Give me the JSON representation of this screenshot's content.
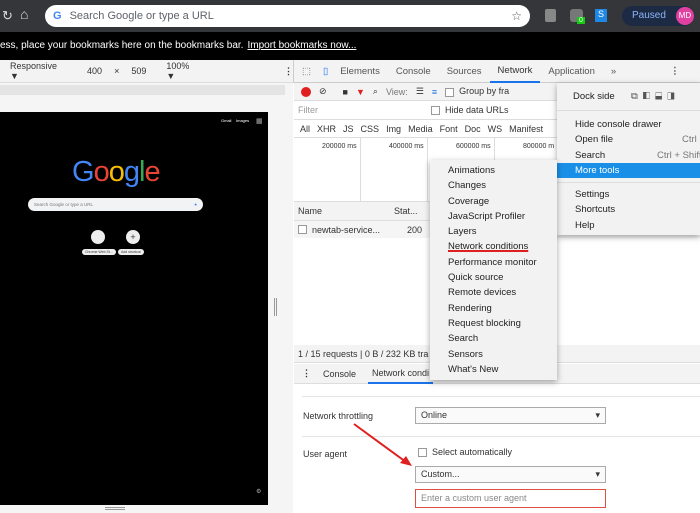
{
  "browser": {
    "address_placeholder": "Search Google or type a URL",
    "profile_status": "Paused",
    "avatar": "MD",
    "ext_badge": "0"
  },
  "bookmarks_bar": {
    "message": "ess, place your bookmarks here on the bookmarks bar.",
    "import_link": "Import bookmarks now..."
  },
  "device_toolbar": {
    "device": "Responsive ▼",
    "width": "400",
    "x": "×",
    "height": "509",
    "zoom": "100% ▼"
  },
  "page": {
    "logo": "Google",
    "links": [
      "Gmail",
      "Images"
    ],
    "search_placeholder": "Search Google or type a URL",
    "shortcuts": [
      "Chrome Web St...",
      "Add shortcut"
    ]
  },
  "devtools": {
    "tabs": [
      "Elements",
      "Console",
      "Sources",
      "Network",
      "Application"
    ],
    "more_tabs": "»",
    "toolbar": {
      "view_label": "View:",
      "group_by": "Group by fra"
    },
    "filter_placeholder": "Filter",
    "hide_data_urls": "Hide data URLs",
    "types": [
      "All",
      "XHR",
      "JS",
      "CSS",
      "Img",
      "Media",
      "Font",
      "Doc",
      "WS",
      "Manifest"
    ],
    "timeline": [
      "200000 ms",
      "400000 ms",
      "600000 ms",
      "800000 m"
    ],
    "columns": [
      "Name",
      "Stat..."
    ],
    "rows": [
      {
        "name": "newtab-service...",
        "status": "200"
      }
    ],
    "status": "1 / 15 requests | 0 B / 232 KB tra",
    "drawer_tabs": [
      "Console",
      "Network condi"
    ],
    "network_conditions": {
      "throttling_label": "Network throttling",
      "throttling_value": "Online",
      "ua_label": "User agent",
      "select_auto": "Select automatically",
      "ua_value": "Custom...",
      "ua_placeholder": "Enter a custom user agent"
    }
  },
  "main_menu": {
    "dock_side": "Dock side",
    "items": [
      {
        "label": "Hide console drawer",
        "shortcut": ""
      },
      {
        "label": "Open file",
        "shortcut": "Ctrl"
      },
      {
        "label": "Search",
        "shortcut": "Ctrl + Shift"
      },
      {
        "label": "More tools",
        "shortcut": ""
      },
      {
        "label": "Settings",
        "shortcut": ""
      },
      {
        "label": "Shortcuts",
        "shortcut": ""
      },
      {
        "label": "Help",
        "shortcut": ""
      }
    ]
  },
  "more_tools_menu": [
    "Animations",
    "Changes",
    "Coverage",
    "JavaScript Profiler",
    "Layers",
    "Network conditions",
    "Performance monitor",
    "Quick source",
    "Remote devices",
    "Rendering",
    "Request blocking",
    "Search",
    "Sensors",
    "What's New"
  ],
  "colors": {
    "accent": "#1a8fe8",
    "annotation": "#e02020"
  }
}
